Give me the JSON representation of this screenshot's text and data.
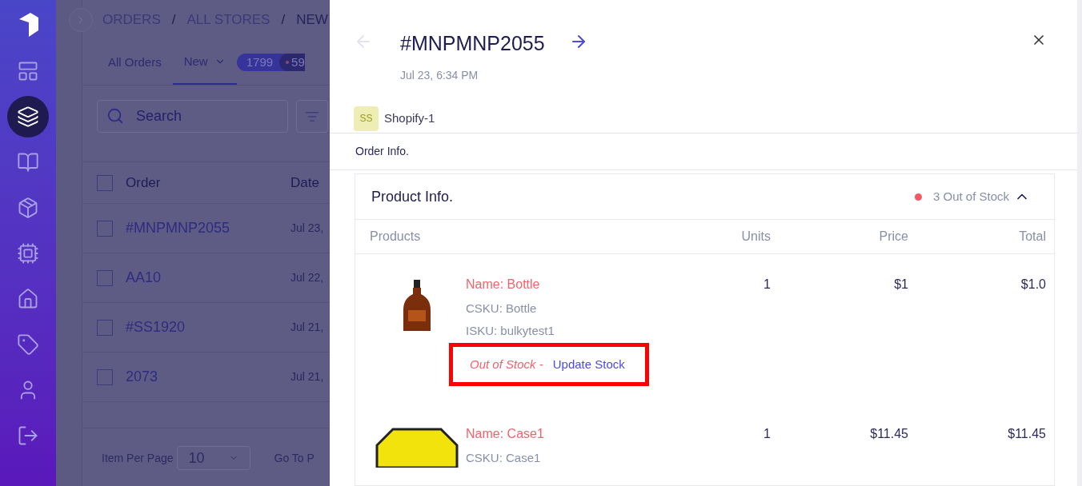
{
  "sidebar": {
    "items": [
      {
        "selected": false
      },
      {
        "selected": true
      },
      {
        "selected": false
      },
      {
        "selected": false
      },
      {
        "selected": false
      },
      {
        "selected": false
      },
      {
        "selected": false
      },
      {
        "selected": false
      },
      {
        "selected": false
      }
    ]
  },
  "background_page": {
    "breadcrumb": [
      "ORDERS",
      "ALL STORES",
      "NEW"
    ],
    "separator": "/",
    "tabs": [
      {
        "label": "All Orders",
        "selected": false,
        "dropdown": false
      },
      {
        "label": "New",
        "selected": true,
        "dropdown": true
      }
    ],
    "counts": [
      "1799",
      "59"
    ],
    "search": {
      "placeholder": "Search"
    },
    "table": {
      "columns": [
        "Order",
        "Date"
      ],
      "all_checked": false,
      "rows": [
        {
          "order": "#MNPMNP2055",
          "date": "Jul 23,",
          "checked": false
        },
        {
          "order": "AA10",
          "date": "Jul 22,",
          "checked": false
        },
        {
          "order": "#SS1920",
          "date": "Jul 21,",
          "checked": false
        },
        {
          "order": "2073",
          "date": "Jul 21,",
          "checked": false
        }
      ]
    },
    "footer": {
      "items_per_page_label": "Item Per Page",
      "items_per_page": "10",
      "go_to_page_label": "Go To P"
    }
  },
  "drawer": {
    "title": "#MNPMNP2055",
    "date": "Jul 23, 6:34 PM",
    "prev_disabled": true,
    "next_disabled": false,
    "store": {
      "initials": "SS",
      "name": "Shopify-1"
    },
    "section": "Order Info.",
    "product_card": {
      "title": "Product Info.",
      "status": "3 Out of Stock",
      "expanded": true,
      "columns": [
        "Products",
        "Units",
        "Price",
        "Total"
      ],
      "products": [
        {
          "kind": "bottle",
          "name": "Name: Bottle",
          "csku": "CSKU: Bottle",
          "isku": "ISKU: bulkytest1",
          "out_of_stock": "Out of Stock -",
          "action": "Update Stock",
          "highlighted": true,
          "units": "1",
          "price": "$1",
          "total": "$1.0"
        },
        {
          "kind": "sign",
          "name": "Name: Case1",
          "csku": "CSKU: Case1",
          "units": "1",
          "price": "$11.45",
          "total": "$11.45"
        }
      ]
    }
  }
}
